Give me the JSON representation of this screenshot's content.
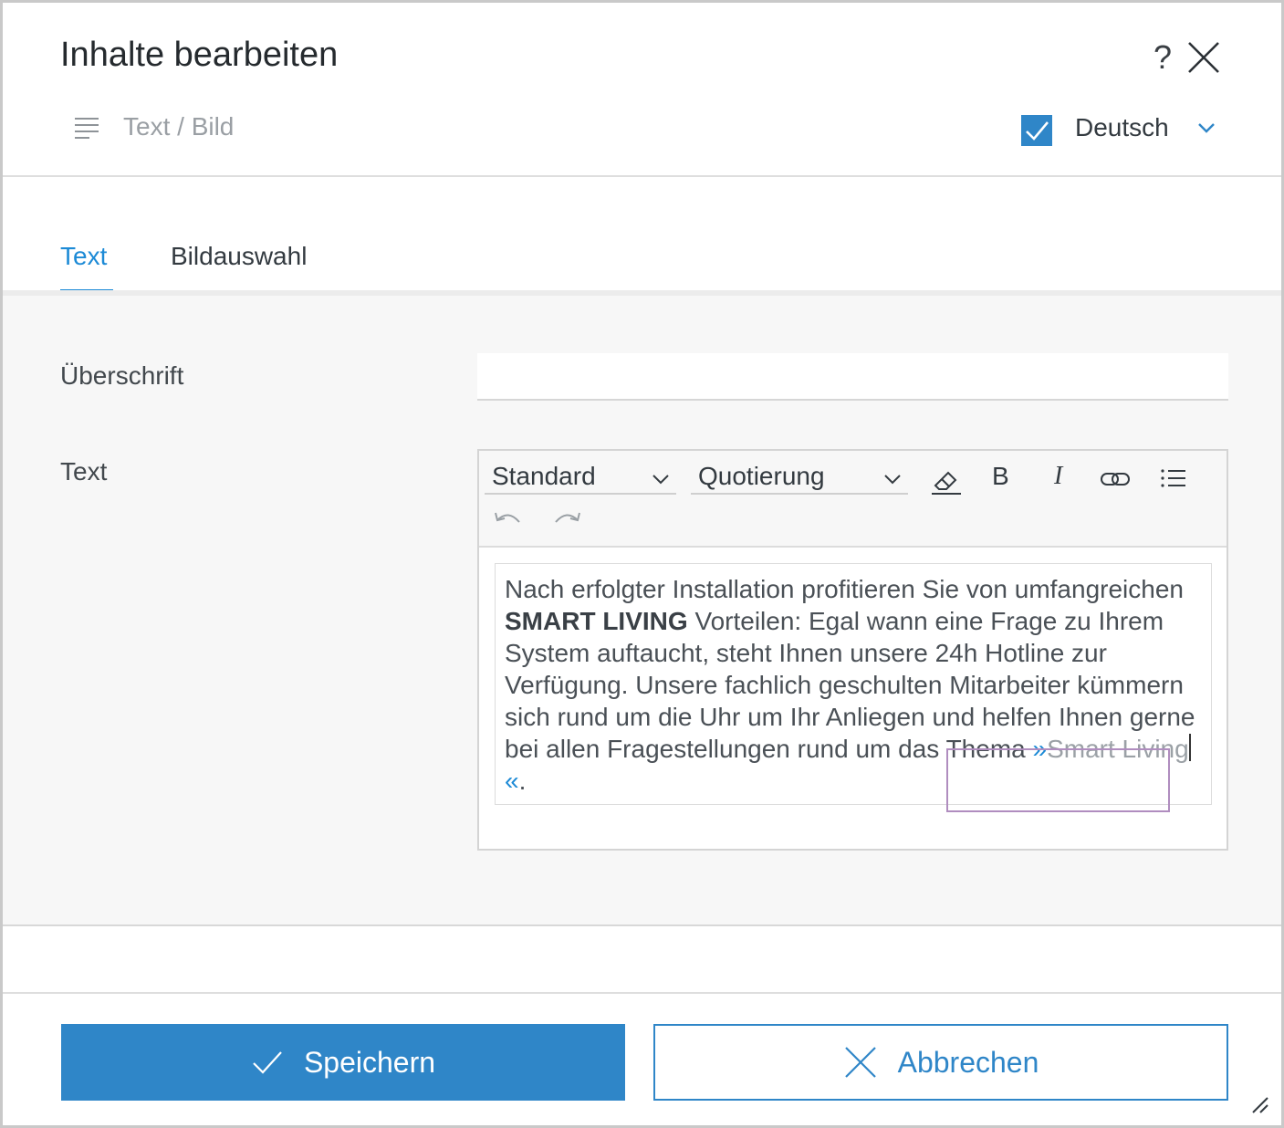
{
  "dialog": {
    "title": "Inhalte bearbeiten",
    "help_glyph": "?",
    "subtitle": "Text / Bild",
    "language": "Deutsch",
    "language_checked": true
  },
  "tabs": [
    {
      "label": "Text",
      "active": true
    },
    {
      "label": "Bildauswahl",
      "active": false
    }
  ],
  "form": {
    "heading_label": "Überschrift",
    "heading_value": "",
    "text_label": "Text"
  },
  "toolbar": {
    "block_format": "Standard",
    "quote_format": "Quotierung",
    "bold_label": "B",
    "italic_label": "I",
    "icons": [
      "eraser-icon",
      "link-icon",
      "list-icon",
      "undo-icon",
      "redo-icon"
    ]
  },
  "editor": {
    "text_before": "Nach erfolgter Installation profitieren Sie von umfangreichen ",
    "text_bold": "SMART LIVING",
    "text_after": " Vorteilen: Egal wann eine Frage zu Ihrem System auftaucht, steht Ihnen unsere 24h Hotline zur Verfügung. Unsere fachlich geschulten Mitarbeiter kümmern sich rund um die Uhr um Ihr Anliegen und helfen Ihnen gerne bei allen Fragestellungen rund um das Thema ",
    "quote_open": "»",
    "quote_text": "Smart Living",
    "quote_close": "«",
    "text_end": "."
  },
  "footer": {
    "save_label": "Speichern",
    "cancel_label": "Abbrechen"
  },
  "colors": {
    "accent": "#2f86c8",
    "tab_active": "#1c8ad6",
    "highlight_box": "#b08dbf"
  }
}
